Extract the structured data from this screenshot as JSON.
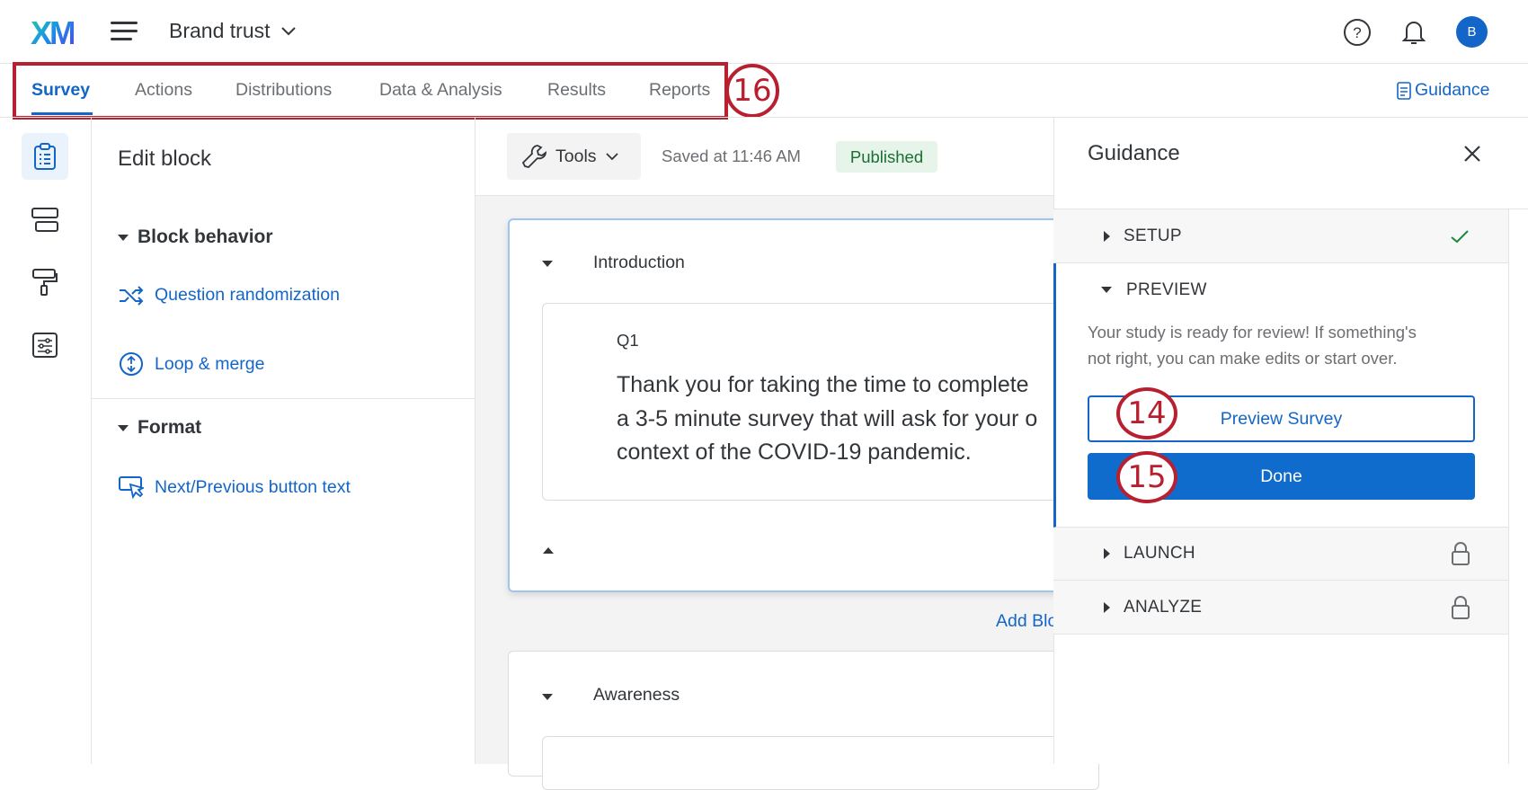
{
  "header": {
    "logo": "XM",
    "project_title": "Brand trust",
    "avatar_initial": "B",
    "icons": [
      "menu-icon",
      "chevron-down-icon",
      "help-icon",
      "bell-icon"
    ]
  },
  "tabs": [
    {
      "label": "Survey",
      "active": true
    },
    {
      "label": "Actions"
    },
    {
      "label": "Distributions"
    },
    {
      "label": "Data & Analysis"
    },
    {
      "label": "Results"
    },
    {
      "label": "Reports"
    }
  ],
  "guidance_link": "Guidance",
  "annotations": {
    "tabs": "16",
    "preview": "14",
    "done": "15"
  },
  "edit_block": {
    "title": "Edit block",
    "block_behavior": {
      "heading": "Block behavior",
      "items": [
        "Question randomization",
        "Loop & merge"
      ]
    },
    "format": {
      "heading": "Format",
      "items": [
        "Next/Previous button text"
      ]
    }
  },
  "toolbar": {
    "tools_label": "Tools",
    "saved_text": "Saved at 11:46 AM",
    "status_badge": "Published"
  },
  "blocks": [
    {
      "name": "Introduction",
      "question": {
        "id": "Q1",
        "text_lines": [
          "Thank you for taking the time to complete",
          "a 3-5 minute survey that will ask for your o",
          "context of the COVID-19 pandemic."
        ]
      }
    },
    {
      "name": "Awareness"
    }
  ],
  "add_block_label": "Add Block",
  "guidance_panel": {
    "title": "Guidance",
    "sections": [
      {
        "label": "SETUP",
        "status": "complete"
      },
      {
        "label": "PREVIEW",
        "expanded": true,
        "description_lines": [
          "Your study is ready for review! If something's",
          "not right, you can make edits or start over."
        ],
        "preview_button": "Preview Survey",
        "done_button": "Done"
      },
      {
        "label": "LAUNCH",
        "status": "locked"
      },
      {
        "label": "ANALYZE",
        "status": "locked"
      }
    ]
  },
  "colors": {
    "accent": "#1366c8",
    "annotation": "#b8202f",
    "published_bg": "#e6f4ea",
    "published_text": "#1b6e31"
  }
}
